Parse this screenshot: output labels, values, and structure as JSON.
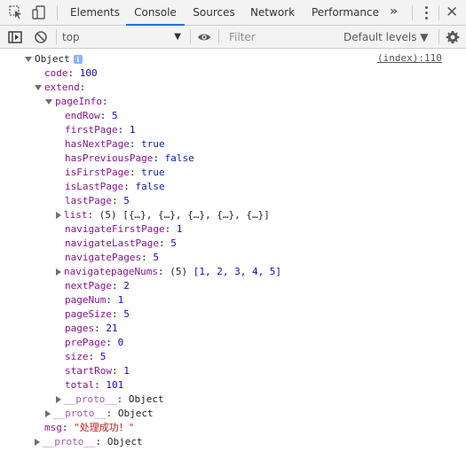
{
  "tabs": [
    "Elements",
    "Console",
    "Sources",
    "Network",
    "Performance"
  ],
  "more_tabs": "»",
  "toolbar": {
    "context": "top",
    "filter_placeholder": "Filter",
    "levels": "Default levels ▼"
  },
  "log": {
    "source": "(index):110",
    "root": "Object",
    "code_key": "code",
    "code_val": "100",
    "extend_key": "extend",
    "pageinfo_key": "pageInfo",
    "fields": [
      {
        "k": "endRow",
        "v": "5"
      },
      {
        "k": "firstPage",
        "v": "1"
      },
      {
        "k": "hasNextPage",
        "v": "true"
      },
      {
        "k": "hasPreviousPage",
        "v": "false"
      },
      {
        "k": "isFirstPage",
        "v": "true"
      },
      {
        "k": "isLastPage",
        "v": "false"
      },
      {
        "k": "lastPage",
        "v": "5"
      }
    ],
    "list_key": "list",
    "list_count": "(5)",
    "list_preview": "[{…}, {…}, {…}, {…}, {…}]",
    "fields2": [
      {
        "k": "navigateFirstPage",
        "v": "1"
      },
      {
        "k": "navigateLastPage",
        "v": "5"
      },
      {
        "k": "navigatePages",
        "v": "5"
      }
    ],
    "navnums_key": "navigatepageNums",
    "navnums_count": "(5)",
    "navnums_preview": "[1, 2, 3, 4, 5]",
    "fields3": [
      {
        "k": "nextPage",
        "v": "2"
      },
      {
        "k": "pageNum",
        "v": "1"
      },
      {
        "k": "pageSize",
        "v": "5"
      },
      {
        "k": "pages",
        "v": "21"
      },
      {
        "k": "prePage",
        "v": "0"
      },
      {
        "k": "size",
        "v": "5"
      },
      {
        "k": "startRow",
        "v": "1"
      },
      {
        "k": "total",
        "v": "101"
      }
    ],
    "proto_key": "__proto__",
    "proto_val": "Object",
    "msg_key": "msg",
    "msg_val": "\"处理成功！\""
  },
  "colors": {
    "key": "#881391",
    "number": "#1c00cf",
    "string": "#c41a16",
    "accent": "#1a73e8"
  }
}
